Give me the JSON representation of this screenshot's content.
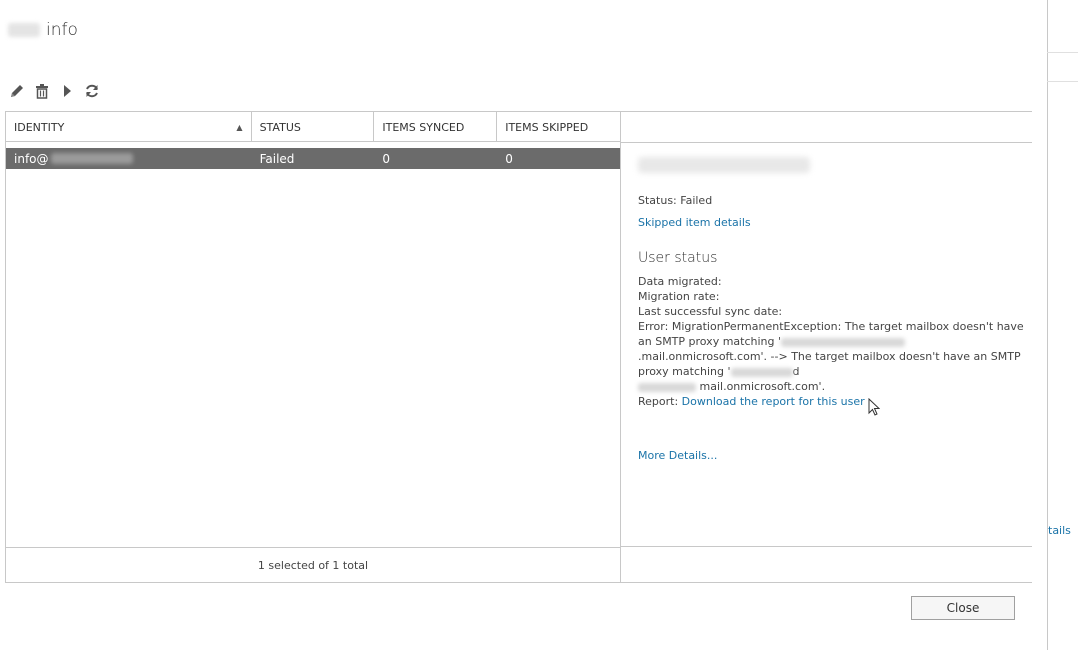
{
  "title": {
    "suffix": "info"
  },
  "toolbar": {
    "edit": "pencil-icon",
    "delete": "trash-icon",
    "start": "play-icon",
    "refresh": "refresh-icon"
  },
  "grid": {
    "columns": [
      "IDENTITY",
      "STATUS",
      "ITEMS SYNCED",
      "ITEMS SKIPPED"
    ],
    "rows": [
      {
        "identity": "info@",
        "status": "Failed",
        "synced": "0",
        "skipped": "0"
      }
    ],
    "footer": "1 selected of 1 total"
  },
  "details": {
    "status": "Status: Failed",
    "skipped_link": "Skipped item details",
    "user_status_title": "User status",
    "data_migrated": "Data migrated:",
    "migration_rate": "Migration rate:",
    "last_sync": "Last successful sync date:",
    "error_1": "Error: MigrationPermanentException: The target mailbox doesn't have an SMTP proxy matching '",
    "error_2": ".mail.onmicrosoft.com'. --> The target mailbox doesn't have an SMTP proxy matching '",
    "error_3": "d",
    "error_4": "mail.onmicrosoft.com'.",
    "report_label": "Report: ",
    "report_link": "Download the report for this user",
    "more_details": "More Details..."
  },
  "background": {
    "partial_link": "tails"
  },
  "close_label": "Close",
  "colors": {
    "link": "#1a73a8",
    "selected_row": "#6b6b6b"
  }
}
